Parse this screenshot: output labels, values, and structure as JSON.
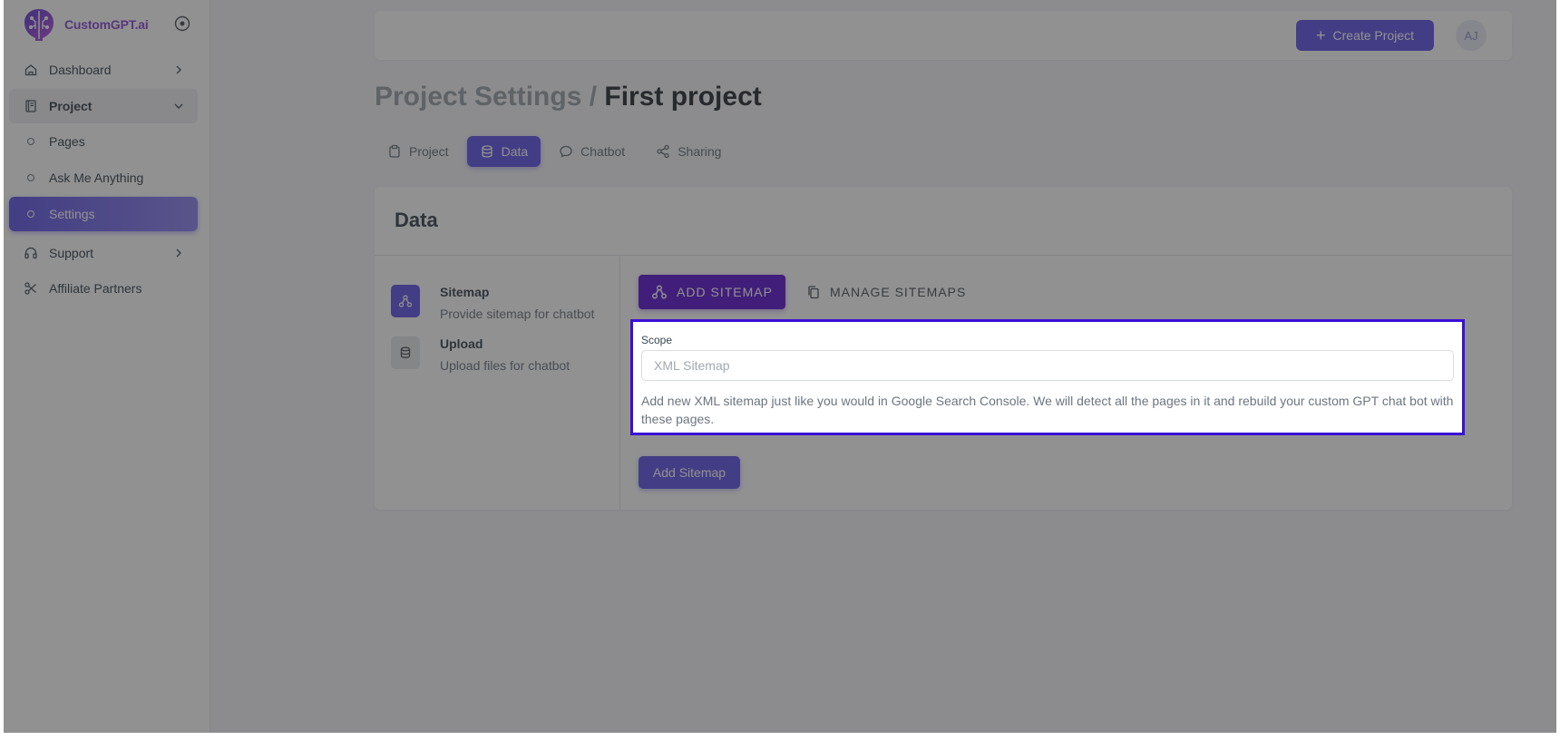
{
  "sidebar": {
    "brand": "CustomGPT.ai",
    "items": [
      {
        "label": "Dashboard"
      },
      {
        "label": "Project"
      },
      {
        "label": "Pages"
      },
      {
        "label": "Ask Me Anything"
      },
      {
        "label": "Settings"
      },
      {
        "label": "Support"
      },
      {
        "label": "Affiliate Partners"
      }
    ]
  },
  "header": {
    "create_label": "Create Project",
    "avatar_initials": "AJ"
  },
  "title": {
    "prefix": "Project Settings / ",
    "current": "First project"
  },
  "tabs": [
    {
      "label": "Project"
    },
    {
      "label": "Data"
    },
    {
      "label": "Chatbot"
    },
    {
      "label": "Sharing"
    }
  ],
  "card": {
    "title": "Data",
    "options": [
      {
        "title": "Sitemap",
        "desc": "Provide sitemap for chatbot"
      },
      {
        "title": "Upload",
        "desc": "Upload files for chatbot"
      }
    ],
    "add_tab_label": "ADD SITEMAP",
    "manage_tab_label": "MANAGE SITEMAPS",
    "scope_label": "Scope",
    "scope_placeholder": "XML Sitemap",
    "scope_help": "Add new XML sitemap just like you would in Google Search Console. We will detect all the pages in it and rebuild your custom GPT chat bot with these pages.",
    "submit_label": "Add Sitemap"
  },
  "colors": {
    "primary": "#6357e6",
    "highlight_border": "#3a0fd6",
    "add_sitemap_tab": "#5f19d0"
  }
}
